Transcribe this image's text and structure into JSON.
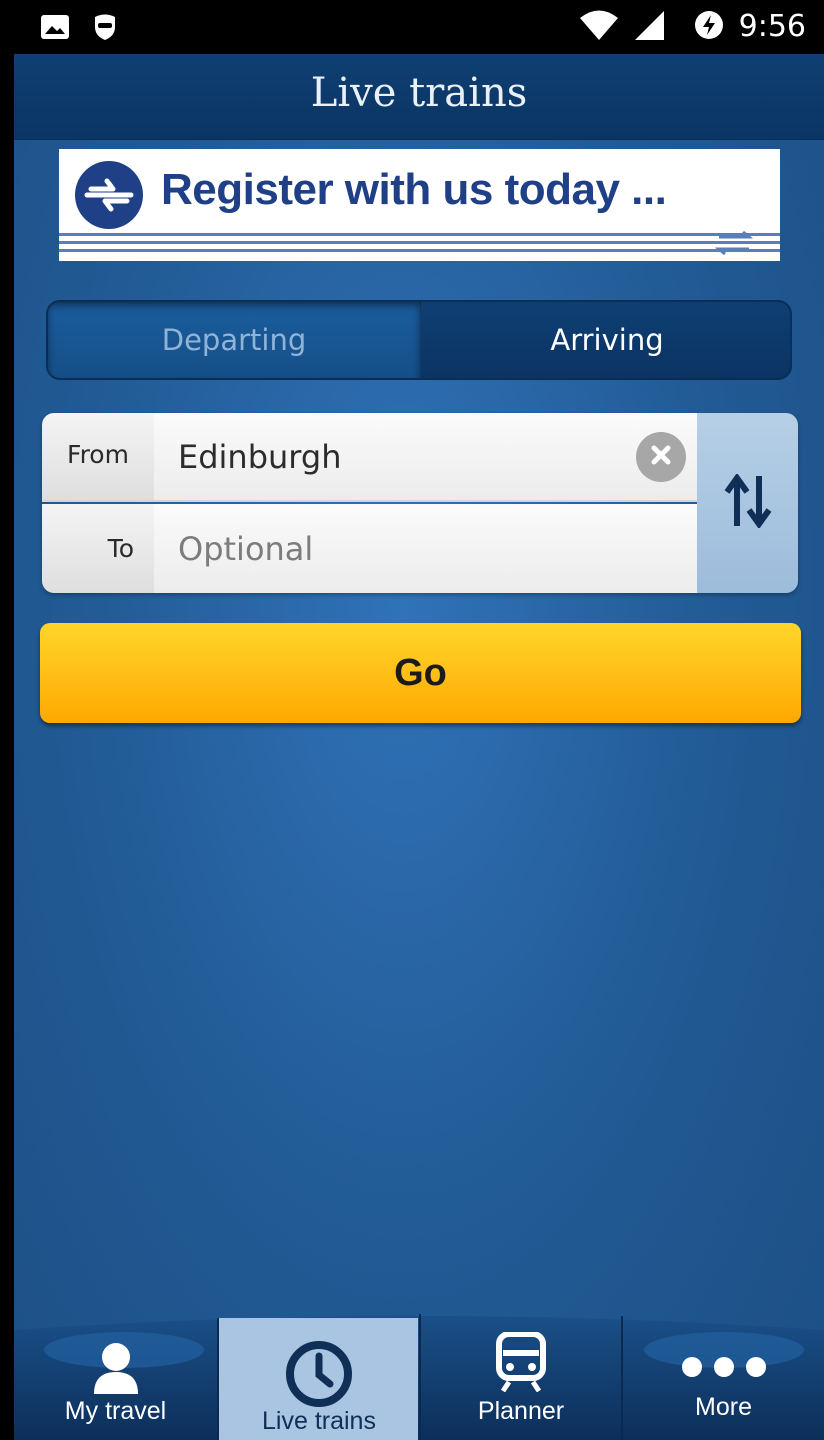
{
  "status_bar": {
    "time": "9:56",
    "icons": [
      "image-icon",
      "vpn-mask-icon",
      "wifi-icon",
      "signal-icon",
      "data-saver-icon"
    ]
  },
  "header": {
    "title": "Live trains"
  },
  "banner": {
    "text": "Register with us today ...",
    "logo": "national-rail-logo"
  },
  "segment": {
    "options": [
      {
        "label": "Departing",
        "selected": false
      },
      {
        "label": "Arriving",
        "selected": true
      }
    ]
  },
  "form": {
    "from_label": "From",
    "from_value": "Edinburgh",
    "to_label": "To",
    "to_placeholder": "Optional",
    "clear_icon": "clear-icon",
    "swap_icon": "swap-arrows-icon"
  },
  "go_label": "Go",
  "bottom_nav": {
    "items": [
      {
        "label": "My travel",
        "icon": "person-icon",
        "active": false
      },
      {
        "label": "Live trains",
        "icon": "clock-icon",
        "active": true
      },
      {
        "label": "Planner",
        "icon": "train-icon",
        "active": false
      },
      {
        "label": "More",
        "icon": "more-dots-icon",
        "active": false
      }
    ]
  },
  "colors": {
    "header": "#0f3f73",
    "background": "#2a67a8",
    "go_button": "#ffc21a",
    "banner_text": "#1f3f86",
    "active_tab": "#b6cfe6"
  }
}
